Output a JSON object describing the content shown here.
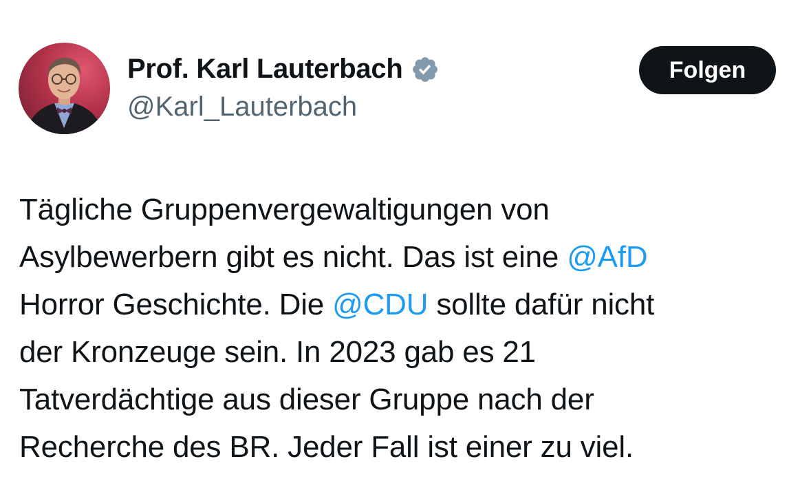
{
  "author": {
    "display_name": "Prof. Karl Lauterbach",
    "handle": "@Karl_Lauterbach",
    "verified_icon": "verified-badge-icon",
    "avatar_icon": "profile-photo"
  },
  "follow_button": {
    "label": "Folgen"
  },
  "tweet": {
    "lines": [
      {
        "parts": [
          "Tägliche Gruppenvergewaltigungen von"
        ]
      },
      {
        "parts": [
          "Asylbewerbern gibt es nicht. Das ist eine ",
          "@AfD"
        ]
      },
      {
        "parts": [
          "Horror Geschichte. Die ",
          "@CDU",
          " sollte dafür nicht"
        ]
      },
      {
        "parts": [
          "der Kronzeuge sein. In 2023 gab es 21"
        ]
      },
      {
        "parts": [
          "Tatverdächtige aus dieser Gruppe nach der"
        ]
      },
      {
        "parts": [
          "Recherche des BR. Jeder Fall ist einer zu viel."
        ]
      }
    ]
  },
  "colors": {
    "text": "#0f1419",
    "secondary_text": "#536471",
    "link": "#1d9bf0",
    "verified_badge": "#829aab",
    "button_bg": "#0f1419",
    "button_text": "#ffffff"
  }
}
